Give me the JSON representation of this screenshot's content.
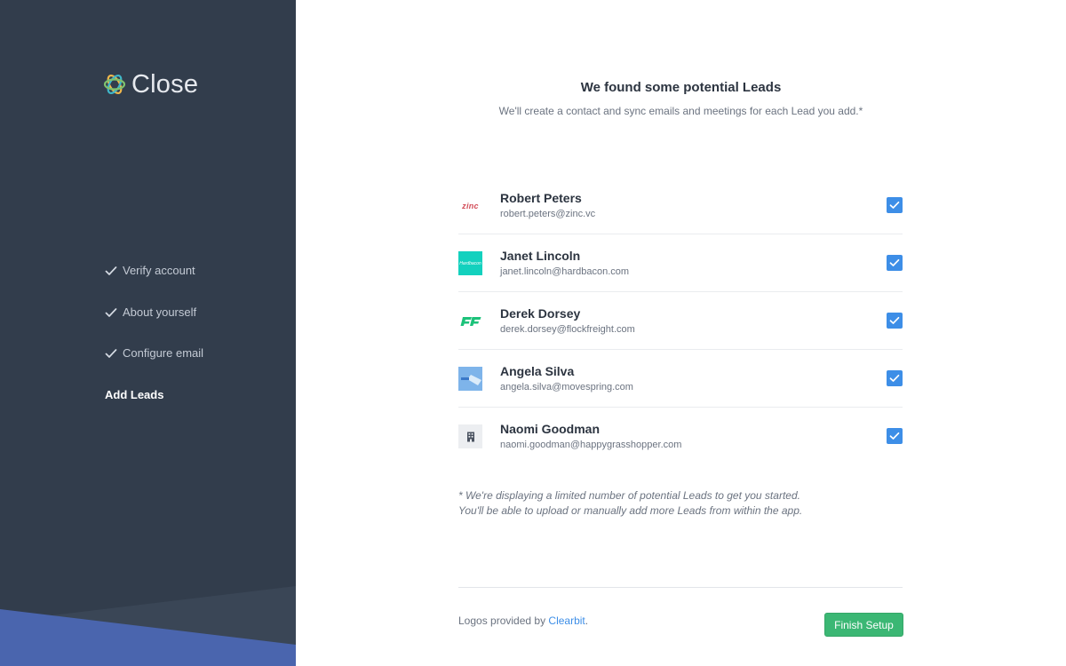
{
  "brand": {
    "name": "Close",
    "sidebar_bg": "#323d4c",
    "accent_blue": "#3d8ee7",
    "accent_green": "#3bb774"
  },
  "sidebar": {
    "steps": [
      {
        "label": "Verify account",
        "done": true
      },
      {
        "label": "About yourself",
        "done": true
      },
      {
        "label": "Configure email",
        "done": true
      },
      {
        "label": "Add Leads",
        "done": false,
        "active": true
      }
    ]
  },
  "main": {
    "title": "We found some potential Leads",
    "subtitle": "We'll create a contact and sync emails and meetings for each Lead you add.*",
    "leads": [
      {
        "name": "Robert Peters",
        "email": "robert.peters@zinc.vc",
        "logo_icon": "zinc-logo-icon",
        "logo_text": "zinc",
        "checked": true
      },
      {
        "name": "Janet Lincoln",
        "email": "janet.lincoln@hardbacon.com",
        "logo_icon": "hardbacon-logo-icon",
        "logo_text": "Hardbacon",
        "checked": true
      },
      {
        "name": "Derek Dorsey",
        "email": "derek.dorsey@flockfreight.com",
        "logo_icon": "flockfreight-logo-icon",
        "checked": true
      },
      {
        "name": "Angela Silva",
        "email": "angela.silva@movespring.com",
        "logo_icon": "movespring-logo-icon",
        "checked": true
      },
      {
        "name": "Naomi Goodman",
        "email": "naomi.goodman@happygrasshopper.com",
        "logo_icon": "building-icon",
        "checked": true
      }
    ],
    "note_line1": "* We're displaying a limited number of potential Leads to get you started.",
    "note_line2": "You'll be able to upload or manually add more Leads from within the app."
  },
  "footer": {
    "credit_prefix": "Logos provided by ",
    "credit_link": "Clearbit",
    "credit_suffix": ".",
    "finish_label": "Finish Setup"
  }
}
